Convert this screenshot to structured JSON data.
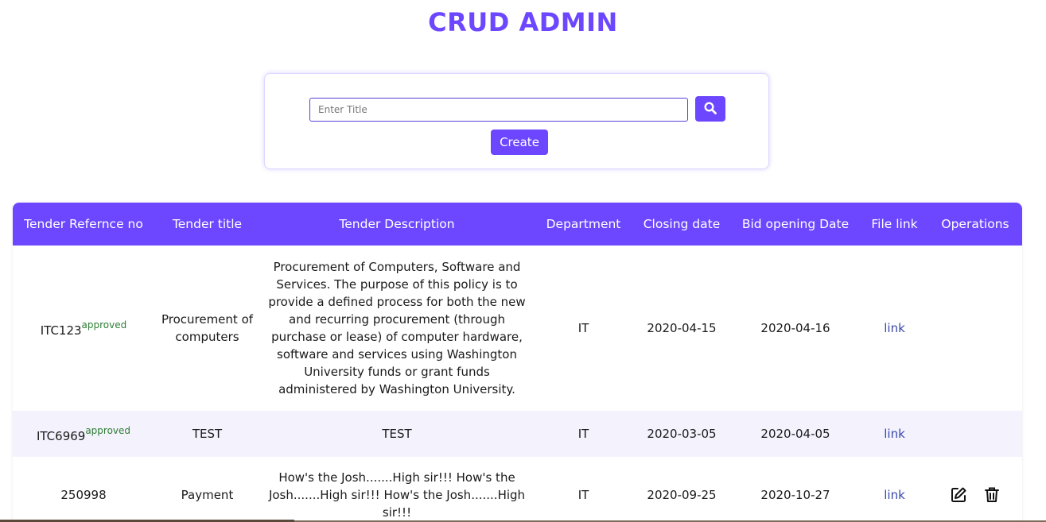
{
  "header": {
    "title": "CRUD ADMIN",
    "accent_color": "#6c47ff"
  },
  "search": {
    "placeholder": "Enter Title",
    "value": "",
    "search_icon": "search-icon",
    "create_label": "Create"
  },
  "table": {
    "columns": [
      "Tender Refernce no",
      "Tender title",
      "Tender Description",
      "Department",
      "Closing date",
      "Bid opening Date",
      "File link",
      "Operations"
    ],
    "rows": [
      {
        "ref": "ITC123",
        "status": "approved",
        "title": "Procurement of computers",
        "description": "Procurement of Computers, Software and Services. The purpose of this policy is to provide a defined process for both the new and recurring procurement (through purchase or lease) of computer hardware, software and services using Washington University funds or grant funds administered by Washington University.",
        "department": "IT",
        "closing_date": "2020-04-15",
        "bid_opening_date": "2020-04-16",
        "file_link": "link",
        "operations": []
      },
      {
        "ref": "ITC6969",
        "status": "approved",
        "title": "TEST",
        "description": "TEST",
        "department": "IT",
        "closing_date": "2020-03-05",
        "bid_opening_date": "2020-04-05",
        "file_link": "link",
        "operations": []
      },
      {
        "ref": "250998",
        "status": "",
        "title": "Payment",
        "description": "How's the Josh.......High sir!!! How's the Josh.......High sir!!! How's the Josh.......High sir!!!",
        "department": "IT",
        "closing_date": "2020-09-25",
        "bid_opening_date": "2020-10-27",
        "file_link": "link",
        "operations": [
          "edit-icon",
          "trash-icon"
        ]
      }
    ]
  }
}
